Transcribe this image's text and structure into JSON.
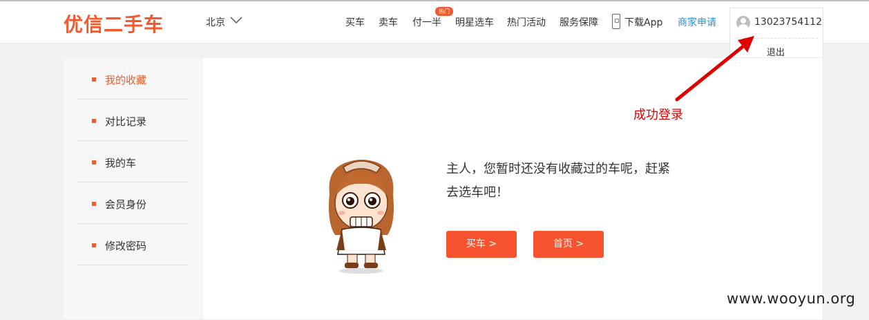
{
  "header": {
    "logo": "优信二手车",
    "city": "北京",
    "nav": {
      "buy": "买车",
      "sell": "卖车",
      "half_pay": "付一半",
      "hot_badge": "热门",
      "star_pick": "明星选车",
      "events": "热门活动",
      "service": "服务保障",
      "download": "下载App",
      "merchant": "商家申请"
    },
    "user": {
      "phone": "13023754112",
      "logout": "退出"
    }
  },
  "sidebar": {
    "items": [
      {
        "label": "我的收藏",
        "active": true
      },
      {
        "label": "对比记录",
        "active": false
      },
      {
        "label": "我的车",
        "active": false
      },
      {
        "label": "会员身份",
        "active": false
      },
      {
        "label": "修改密码",
        "active": false
      }
    ]
  },
  "main": {
    "empty_line1": "主人，您暂时还没有收藏过的车呢，赶紧",
    "empty_line2": "去选车吧！",
    "buy_button": "买车 >",
    "home_button": "首页 >"
  },
  "annotation": "成功登录",
  "watermark": "www.wooyun.org",
  "colors": {
    "brand": "#f15a2e",
    "button": "#f7532f",
    "merchant_link": "#2a8fd6",
    "annotation": "#e10000"
  }
}
